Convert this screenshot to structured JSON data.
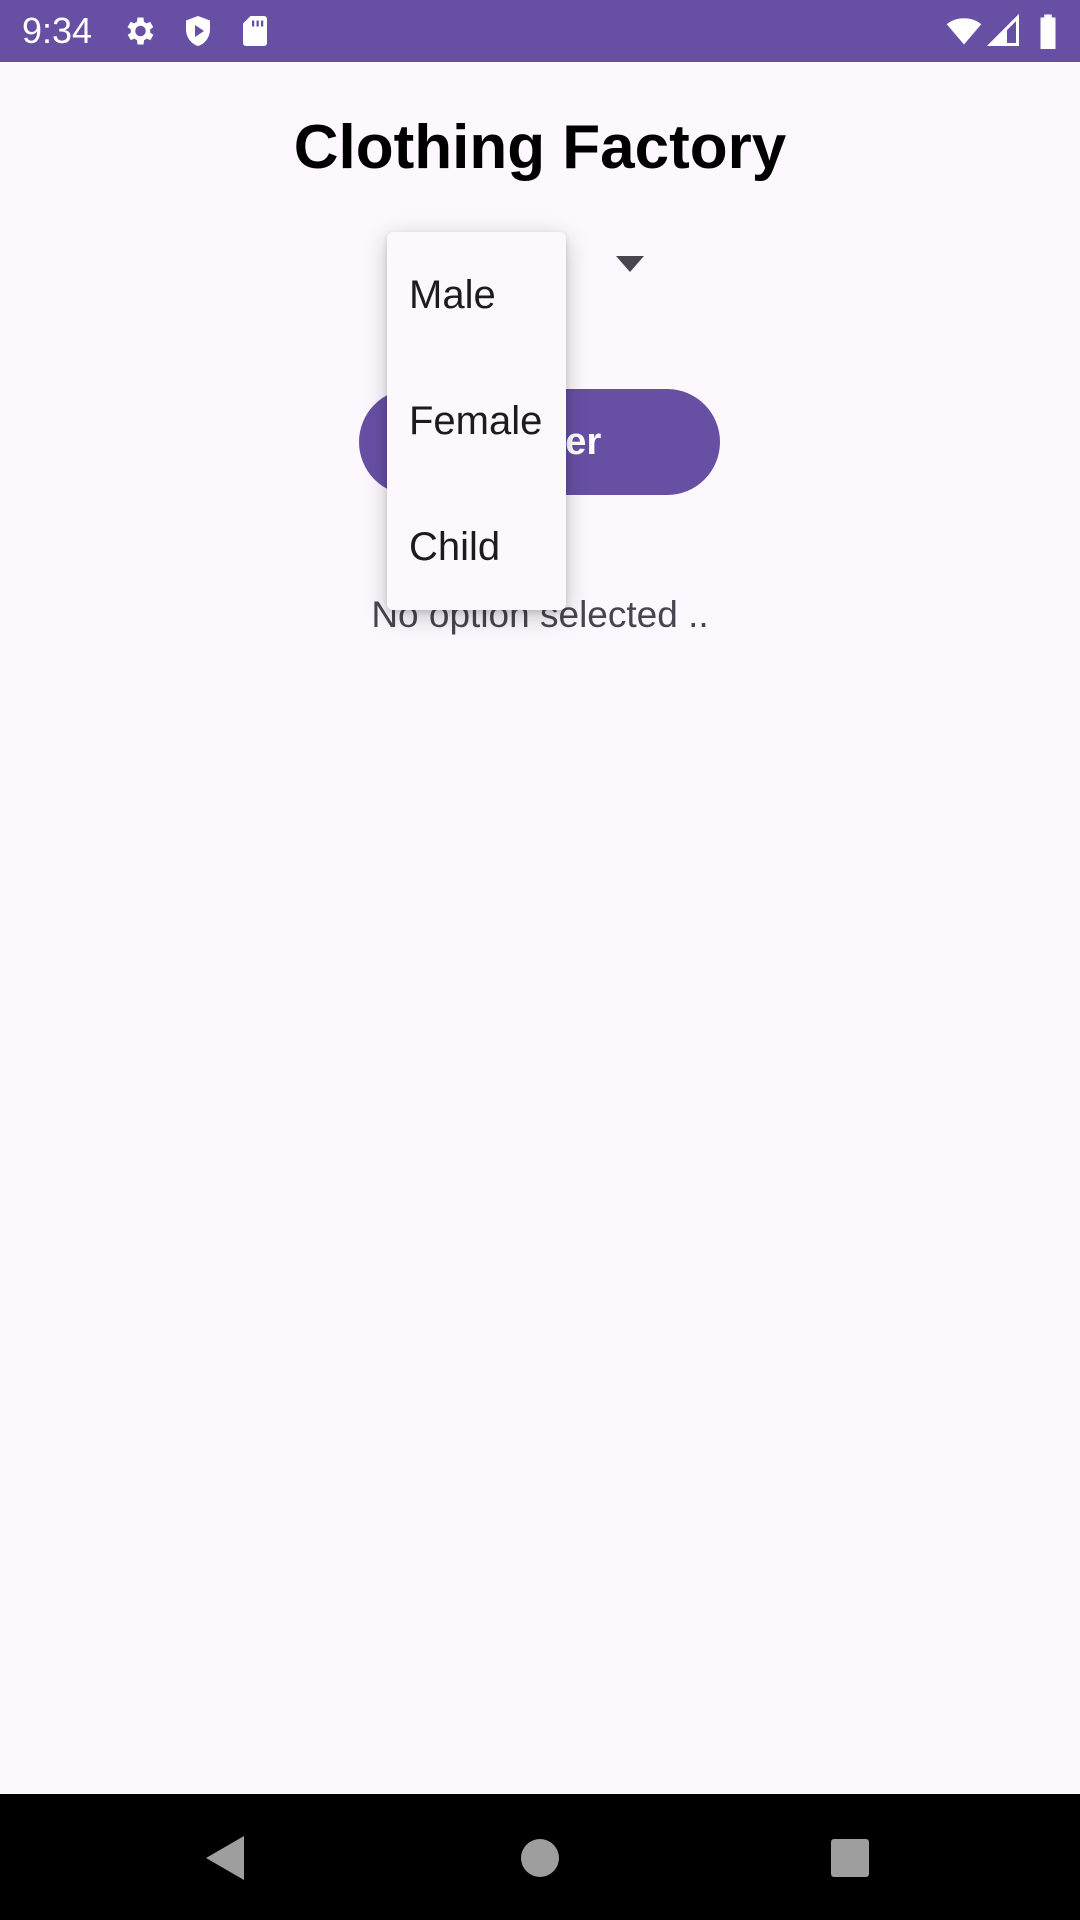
{
  "status_bar": {
    "time": "9:34",
    "left_icons": [
      "gear-icon",
      "shield-play-icon",
      "sd-card-icon"
    ],
    "right_icons": [
      "wifi-icon",
      "cell-signal-icon",
      "battery-icon"
    ],
    "background": "#6750a4"
  },
  "app": {
    "title": "Clothing Factory"
  },
  "spinner": {
    "arrow_icon": "dropdown-arrow-icon",
    "options": [
      "Male",
      "Female",
      "Child"
    ]
  },
  "action_button": {
    "label": "ender",
    "color": "#6750a4"
  },
  "result": {
    "text": "No option selected .."
  },
  "nav_bar": {
    "buttons": [
      "back-icon",
      "home-icon",
      "recents-icon"
    ]
  }
}
